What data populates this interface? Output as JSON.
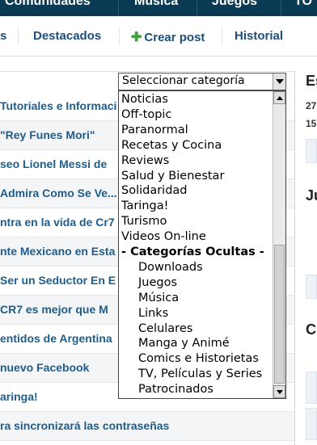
{
  "top_nav": {
    "items": [
      "Comunidades",
      "Música",
      "Juegos",
      "TO"
    ]
  },
  "sub_nav": {
    "items": [
      {
        "label": "s"
      },
      {
        "label": "Destacados"
      },
      {
        "label": "Crear post",
        "icon": "plus-icon"
      },
      {
        "label": "Historial"
      }
    ]
  },
  "posts": [
    {
      "title": "Tutoriales e Informaci"
    },
    {
      "title": "\"Rey Funes Mori\""
    },
    {
      "title": "seo Lionel Messi de"
    },
    {
      "title": "Admira Como Se Ve..."
    },
    {
      "title": "ntra en la vida de Cr7"
    },
    {
      "title": "nte Mexicano en Esta"
    },
    {
      "title": "Ser un Seductor En E"
    },
    {
      "title": "CR7 es mejor que M"
    },
    {
      "title": "entidos de Argentina"
    },
    {
      "title": "nuevo Facebook"
    },
    {
      "title": "aringa!"
    },
    {
      "title": "ra sincronizará las contraseñas"
    }
  ],
  "category_select": {
    "selected": "Seleccionar categoría",
    "options": [
      {
        "label": "Noticias",
        "kind": "normal"
      },
      {
        "label": "Off-topic",
        "kind": "normal"
      },
      {
        "label": "Paranormal",
        "kind": "normal"
      },
      {
        "label": "Recetas y Cocina",
        "kind": "normal"
      },
      {
        "label": "Reviews",
        "kind": "normal"
      },
      {
        "label": "Salud y Bienestar",
        "kind": "normal"
      },
      {
        "label": "Solidaridad",
        "kind": "normal"
      },
      {
        "label": "Taringa!",
        "kind": "normal"
      },
      {
        "label": "Turismo",
        "kind": "normal"
      },
      {
        "label": "Videos On-line",
        "kind": "normal"
      },
      {
        "label": "- Categorías Ocultas -",
        "kind": "group"
      },
      {
        "label": "Downloads",
        "kind": "sub"
      },
      {
        "label": "Juegos",
        "kind": "sub"
      },
      {
        "label": "Música",
        "kind": "sub"
      },
      {
        "label": "Links",
        "kind": "sub"
      },
      {
        "label": "Celulares",
        "kind": "sub"
      },
      {
        "label": "Manga y Animé",
        "kind": "sub"
      },
      {
        "label": "Comics e Historietas",
        "kind": "sub"
      },
      {
        "label": "TV, Películas y Series",
        "kind": "sub"
      },
      {
        "label": "Patrocinados",
        "kind": "sub"
      }
    ]
  },
  "right_col": {
    "heading1": "Es",
    "stat1": "27",
    "stat2": "15",
    "heading2": "Ju",
    "heading3": "C"
  }
}
